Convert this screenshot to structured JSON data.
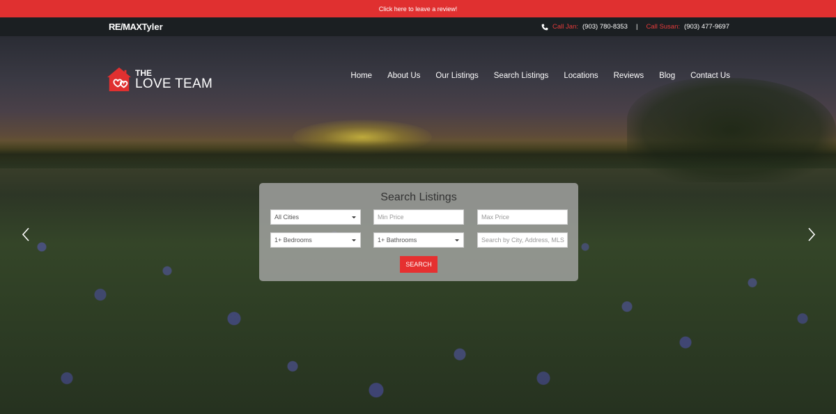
{
  "review_bar": {
    "text": "Click here to leave a review!"
  },
  "top_bar": {
    "logo_remax": "RE/MAX",
    "logo_city": "Tyler",
    "contacts": [
      {
        "label": "Call Jan:",
        "phone": "(903) 780-8353"
      },
      {
        "label": "Call Susan:",
        "phone": "(903) 477-9697"
      }
    ],
    "separator": "|"
  },
  "brand": {
    "the": "THE",
    "name": "LOVE TEAM"
  },
  "nav": {
    "items": [
      {
        "label": "Home"
      },
      {
        "label": "About Us"
      },
      {
        "label": "Our Listings"
      },
      {
        "label": "Search Listings"
      },
      {
        "label": "Locations"
      },
      {
        "label": "Reviews"
      },
      {
        "label": "Blog"
      },
      {
        "label": "Contact Us"
      }
    ]
  },
  "search": {
    "title": "Search Listings",
    "city_select": "All Cities",
    "min_price_placeholder": "Min Price",
    "max_price_placeholder": "Max Price",
    "bedrooms_select": "1+ Bedrooms",
    "bathrooms_select": "1+ Bathrooms",
    "keyword_placeholder": "Search by City, Address, MLS",
    "button_label": "SEARCH"
  },
  "colors": {
    "accent": "#e03030",
    "top_bar_bg": "#1b1f22",
    "phone_label": "#e63b3b"
  },
  "icons": [
    "phone-icon",
    "house-logo-icon",
    "chevron-left-icon",
    "chevron-right-icon",
    "caret-down-icon"
  ]
}
